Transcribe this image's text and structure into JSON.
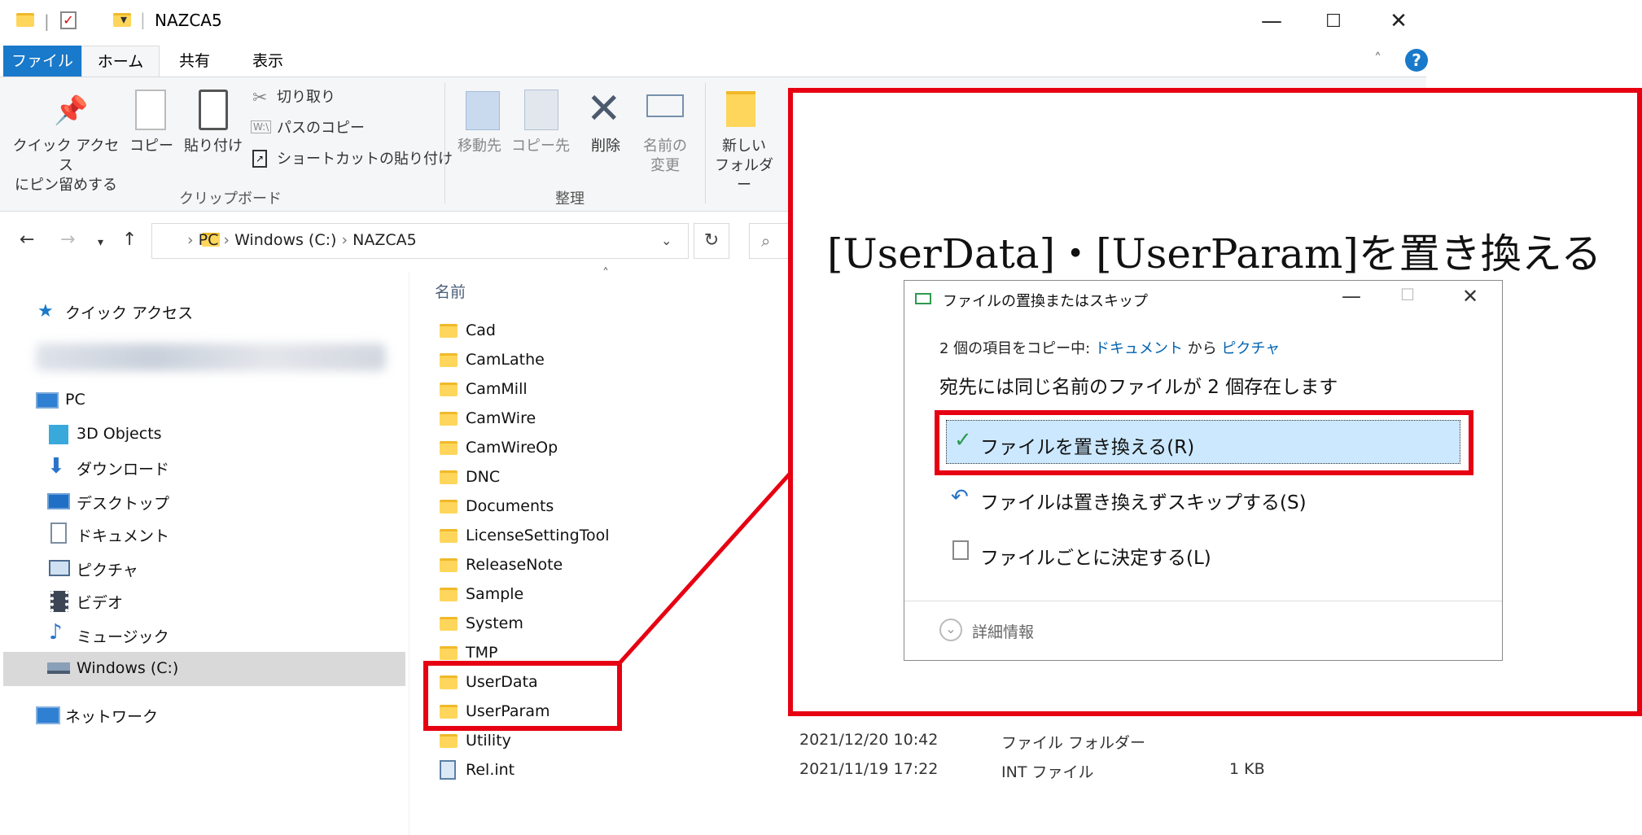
{
  "window": {
    "title": "NAZCA5",
    "controls": {
      "minimize": "—",
      "maximize": "☐",
      "close": "✕"
    }
  },
  "tabs": [
    "ファイル",
    "ホーム",
    "共有",
    "表示"
  ],
  "ribbon": {
    "clipboard": {
      "pin_line1": "クイック アクセス",
      "pin_line2": "にピン留めする",
      "copy": "コピー",
      "paste": "貼り付け",
      "cut": "切り取り",
      "copy_path": "パスのコピー",
      "paste_shortcut": "ショートカットの貼り付け",
      "group_label": "クリップボード"
    },
    "organize": {
      "move_to": "移動先",
      "copy_to": "コピー先",
      "delete": "削除",
      "rename_line1": "名前の",
      "rename_line2": "変更",
      "group_label": "整理"
    },
    "new": {
      "new_folder_line1": "新しい",
      "new_folder_line2": "フォルダー"
    }
  },
  "address": {
    "crumbs": [
      "PC",
      "Windows (C:)",
      "NAZCA5"
    ]
  },
  "nav": {
    "quick_access": "クイック アクセス",
    "pc": "PC",
    "items": [
      "3D Objects",
      "ダウンロード",
      "デスクトップ",
      "ドキュメント",
      "ピクチャ",
      "ビデオ",
      "ミュージック",
      "Windows (C:)"
    ],
    "network": "ネットワーク"
  },
  "list": {
    "name_header": "名前",
    "folders": [
      "Cad",
      "CamLathe",
      "CamMill",
      "CamWire",
      "CamWireOp",
      "DNC",
      "Documents",
      "LicenseSettingTool",
      "ReleaseNote",
      "Sample",
      "System",
      "TMP",
      "UserData",
      "UserParam",
      "Utility"
    ],
    "utility_meta": {
      "date": "2021/12/20 10:42",
      "type": "ファイル フォルダー"
    },
    "file": {
      "name": "Rel.int",
      "date": "2021/11/19 17:22",
      "type": "INT ファイル",
      "size": "1 KB"
    }
  },
  "annotation": {
    "headline": "[UserData]・[UserParam]を置き換える"
  },
  "dialog": {
    "title": "ファイルの置換またはスキップ",
    "copy_prefix": "2 個の項目をコピー中: ",
    "from": "ドキュメント",
    "middle": " から ",
    "to": "ピクチャ",
    "message": "宛先には同じ名前のファイルが 2 個存在します",
    "option_replace": "ファイルを置き換える(R)",
    "option_skip": "ファイルは置き換えずスキップする(S)",
    "option_decide": "ファイルごとに決定する(L)",
    "details": "詳細情報"
  },
  "colors": {
    "accent": "#1979ca",
    "highlight": "#e60012",
    "selection": "#cce8ff"
  }
}
